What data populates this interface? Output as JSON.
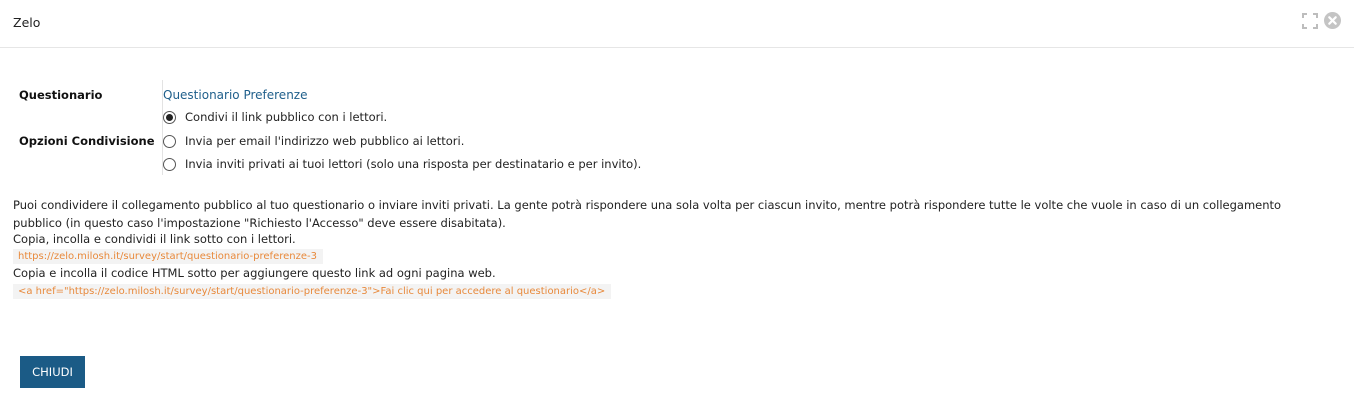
{
  "window": {
    "title": "Zelo",
    "expand_icon": "expand-icon",
    "close_icon": "close-circle-icon"
  },
  "form": {
    "survey_label": "Questionario",
    "survey_value": "Questionario Preferenze",
    "sharing_label": "Opzioni Condivisione",
    "options": [
      {
        "label": "Condivi il link pubblico con i lettori.",
        "checked": true
      },
      {
        "label": "Invia per email l'indirizzo web pubblico ai lettori.",
        "checked": false
      },
      {
        "label": "Invia inviti privati ai tuoi lettori (solo una risposta per destinatario e per invito).",
        "checked": false
      }
    ]
  },
  "info": {
    "description": "Puoi condividere il collegamento pubblico al tuo questionario o inviare inviti privati. La gente potrà rispondere una sola volta per ciascun invito, mentre potrà rispondere tutte le volte che vuole in caso di un collegamento pubblico (in questo caso l'impostazione \"Richiesto l'Accesso\" deve essere disabitata).",
    "copy_link_text": "Copia, incolla e condividi il link sotto con i lettori.",
    "public_link": "https://zelo.milosh.it/survey/start/questionario-preferenze-3",
    "copy_html_text": "Copia e incolla il codice HTML sotto per aggiungere questo link ad ogni pagina web.",
    "html_code": "<a href=\"https://zelo.milosh.it/survey/start/questionario-preferenze-3\">Fai clic qui per accedere al questionario</a>"
  },
  "buttons": {
    "close_label": "CHIUDI"
  },
  "colors": {
    "accent": "#1b5b86",
    "link": "#1f5f8b",
    "code_text": "#e8893b"
  }
}
